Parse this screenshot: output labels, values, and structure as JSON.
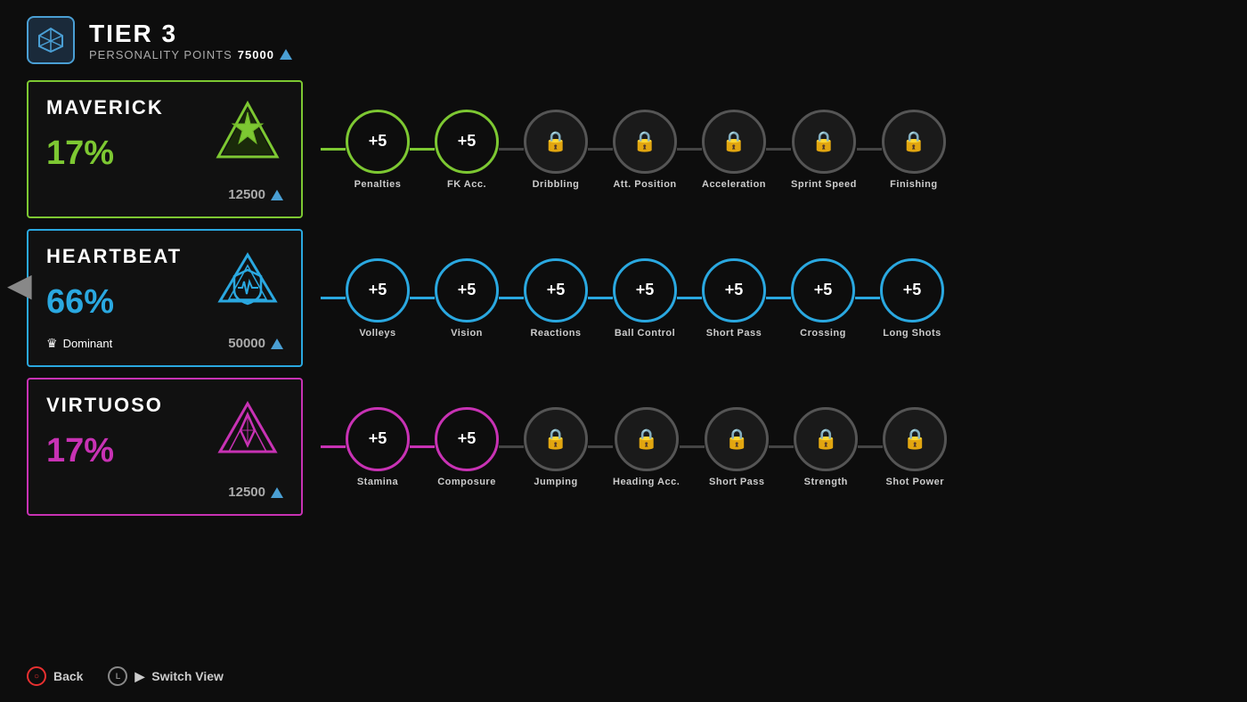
{
  "header": {
    "tier_label": "TIER 3",
    "personality_points_label": "PERSONALITY POINTS",
    "personality_points_value": "75000"
  },
  "personalities": [
    {
      "id": "maverick",
      "name": "MAVERICK",
      "percentage": "17%",
      "cost": "12500",
      "color_class": "card-maverick",
      "pct_class": "pct-maverick",
      "connector_class": "connector-green",
      "active_node_class": "node-active-green",
      "nodes": [
        {
          "label": "Penalties",
          "value": "+5",
          "locked": false
        },
        {
          "label": "FK Acc.",
          "value": "+5",
          "locked": false
        },
        {
          "label": "Dribbling",
          "value": "",
          "locked": true
        },
        {
          "label": "Att. Position",
          "value": "",
          "locked": true
        },
        {
          "label": "Acceleration",
          "value": "",
          "locked": true
        },
        {
          "label": "Sprint Speed",
          "value": "",
          "locked": true
        },
        {
          "label": "Finishing",
          "value": "",
          "locked": true
        }
      ]
    },
    {
      "id": "heartbeat",
      "name": "HEARTBEAT",
      "percentage": "66%",
      "cost": "50000",
      "dominant_label": "Dominant",
      "color_class": "card-heartbeat",
      "pct_class": "pct-heartbeat",
      "connector_class": "connector-blue",
      "active_node_class": "node-active-blue",
      "nodes": [
        {
          "label": "Volleys",
          "value": "+5",
          "locked": false
        },
        {
          "label": "Vision",
          "value": "+5",
          "locked": false
        },
        {
          "label": "Reactions",
          "value": "+5",
          "locked": false
        },
        {
          "label": "Ball Control",
          "value": "+5",
          "locked": false
        },
        {
          "label": "Short Pass",
          "value": "+5",
          "locked": false
        },
        {
          "label": "Crossing",
          "value": "+5",
          "locked": false
        },
        {
          "label": "Long Shots",
          "value": "+5",
          "locked": false
        }
      ]
    },
    {
      "id": "virtuoso",
      "name": "VIRTUOSO",
      "percentage": "17%",
      "cost": "12500",
      "color_class": "card-virtuoso",
      "pct_class": "pct-virtuoso",
      "connector_class": "connector-pink",
      "active_node_class": "node-active-pink",
      "nodes": [
        {
          "label": "Stamina",
          "value": "+5",
          "locked": false
        },
        {
          "label": "Composure",
          "value": "+5",
          "locked": false
        },
        {
          "label": "Jumping",
          "value": "",
          "locked": true
        },
        {
          "label": "Heading Acc.",
          "value": "",
          "locked": true
        },
        {
          "label": "Short Pass",
          "value": "",
          "locked": true
        },
        {
          "label": "Strength",
          "value": "",
          "locked": true
        },
        {
          "label": "Shot Power",
          "value": "",
          "locked": true
        }
      ]
    }
  ],
  "footer": {
    "back_label": "Back",
    "switch_view_label": "Switch View"
  }
}
